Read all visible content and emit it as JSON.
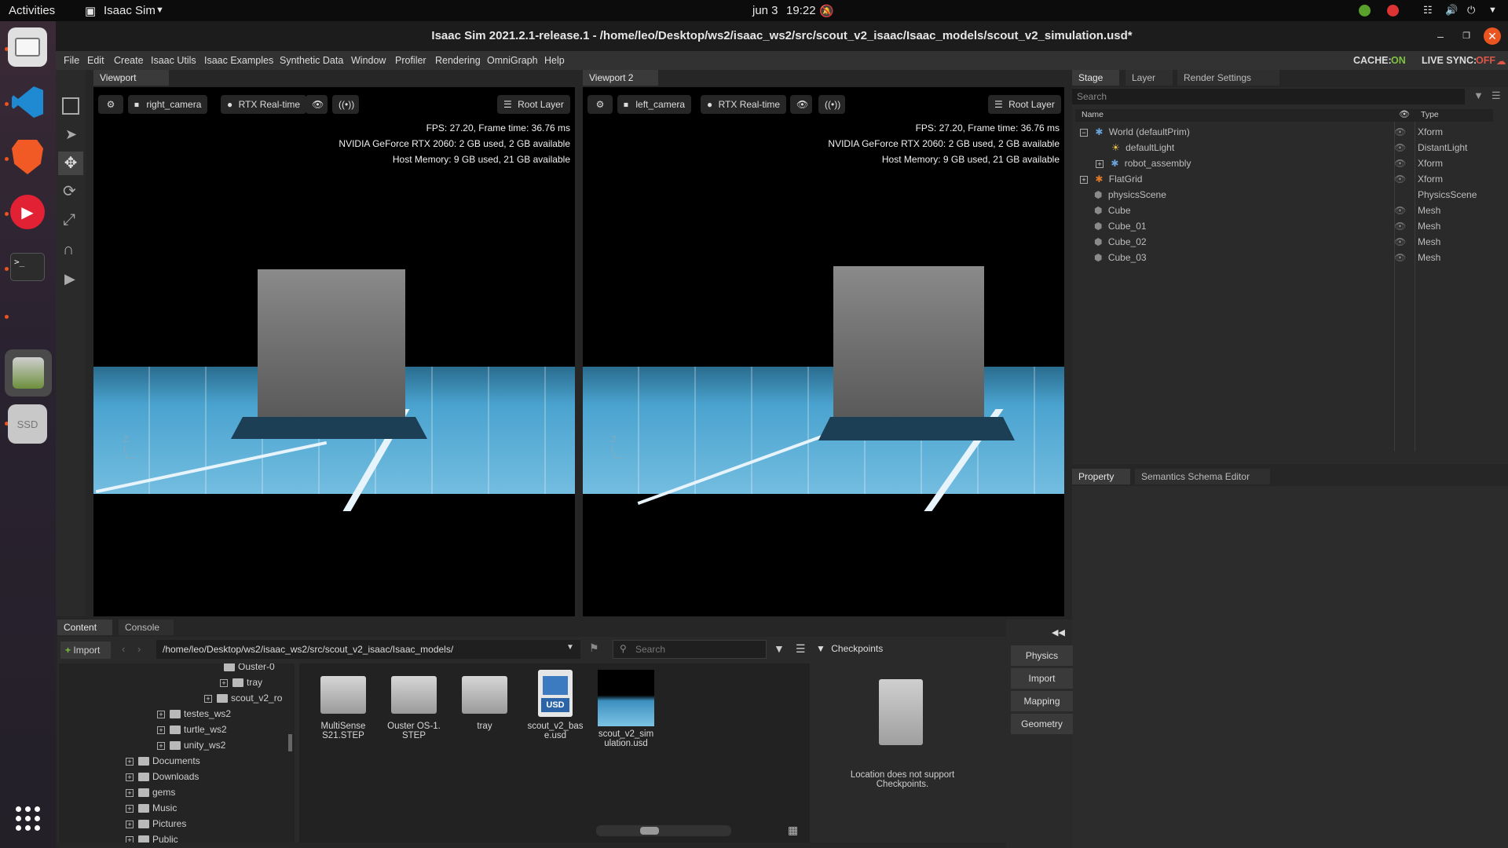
{
  "system": {
    "activities": "Activities",
    "app_menu": "Isaac Sim",
    "date": "jun 3",
    "time": "19:22"
  },
  "window": {
    "title": "Isaac Sim 2021.2.1-release.1 - /home/leo/Desktop/ws2/isaac_ws2/src/scout_v2_isaac/Isaac_models/scout_v2_simulation.usd*"
  },
  "menu": [
    "File",
    "Edit",
    "Create",
    "Isaac Utils",
    "Isaac Examples",
    "Synthetic Data",
    "Window",
    "Profiler",
    "Rendering",
    "OmniGraph",
    "Help"
  ],
  "status": {
    "cache_label": "CACHE:",
    "cache_value": "ON",
    "live_label": "LIVE SYNC:",
    "live_value": "OFF"
  },
  "viewport1": {
    "tab": "Viewport",
    "camera": "right_camera",
    "renderer": "RTX Real-time",
    "layer": "Root Layer",
    "fps": "FPS: 27.20, Frame time: 36.76 ms",
    "gpu": "NVIDIA GeForce RTX 2060: 2 GB used,  2 GB available",
    "host": "Host Memory: 9 GB used, 21 GB available"
  },
  "viewport2": {
    "tab": "Viewport 2",
    "camera": "left_camera",
    "renderer": "RTX Real-time",
    "layer": "Root Layer",
    "fps": "FPS: 27.20, Frame time: 36.76 ms",
    "gpu": "NVIDIA GeForce RTX 2060: 2 GB used,  2 GB available",
    "host": "Host Memory: 9 GB used, 21 GB available"
  },
  "stage": {
    "tabs": [
      "Stage",
      "Layer",
      "Render Settings"
    ],
    "search_placeholder": "Search",
    "col_name": "Name",
    "col_type": "Type",
    "rows": [
      {
        "name": "World (defaultPrim)",
        "type": "Xform"
      },
      {
        "name": "defaultLight",
        "type": "DistantLight"
      },
      {
        "name": "robot_assembly",
        "type": "Xform"
      },
      {
        "name": "FlatGrid",
        "type": "Xform"
      },
      {
        "name": "physicsScene",
        "type": "PhysicsScene"
      },
      {
        "name": "Cube",
        "type": "Mesh"
      },
      {
        "name": "Cube_01",
        "type": "Mesh"
      },
      {
        "name": "Cube_02",
        "type": "Mesh"
      },
      {
        "name": "Cube_03",
        "type": "Mesh"
      }
    ]
  },
  "property": {
    "tabs": [
      "Property",
      "Semantics Schema Editor"
    ]
  },
  "content": {
    "tabs": [
      "Content",
      "Console"
    ],
    "import_label": "Import",
    "path": "/home/leo/Desktop/ws2/isaac_ws2/src/scout_v2_isaac/Isaac_models/",
    "search_placeholder": "Search",
    "tree": [
      "Ouster-0",
      "tray",
      "scout_v2_ro",
      "testes_ws2",
      "turtle_ws2",
      "unity_ws2",
      "Documents",
      "Downloads",
      "gems",
      "Music",
      "Pictures",
      "Public"
    ],
    "files": [
      "MultiSense S21.STEP",
      "Ouster OS-1. STEP",
      "tray",
      "scout_v2_bas e.usd",
      "scout_v2_sim ulation.usd"
    ]
  },
  "checkpoints": {
    "title": "Checkpoints",
    "message": "Location does not support Checkpoints."
  },
  "side_buttons": [
    "Physics",
    "Import",
    "Mapping",
    "Geometry"
  ],
  "dock": {
    "ssd_label": "SSD"
  }
}
